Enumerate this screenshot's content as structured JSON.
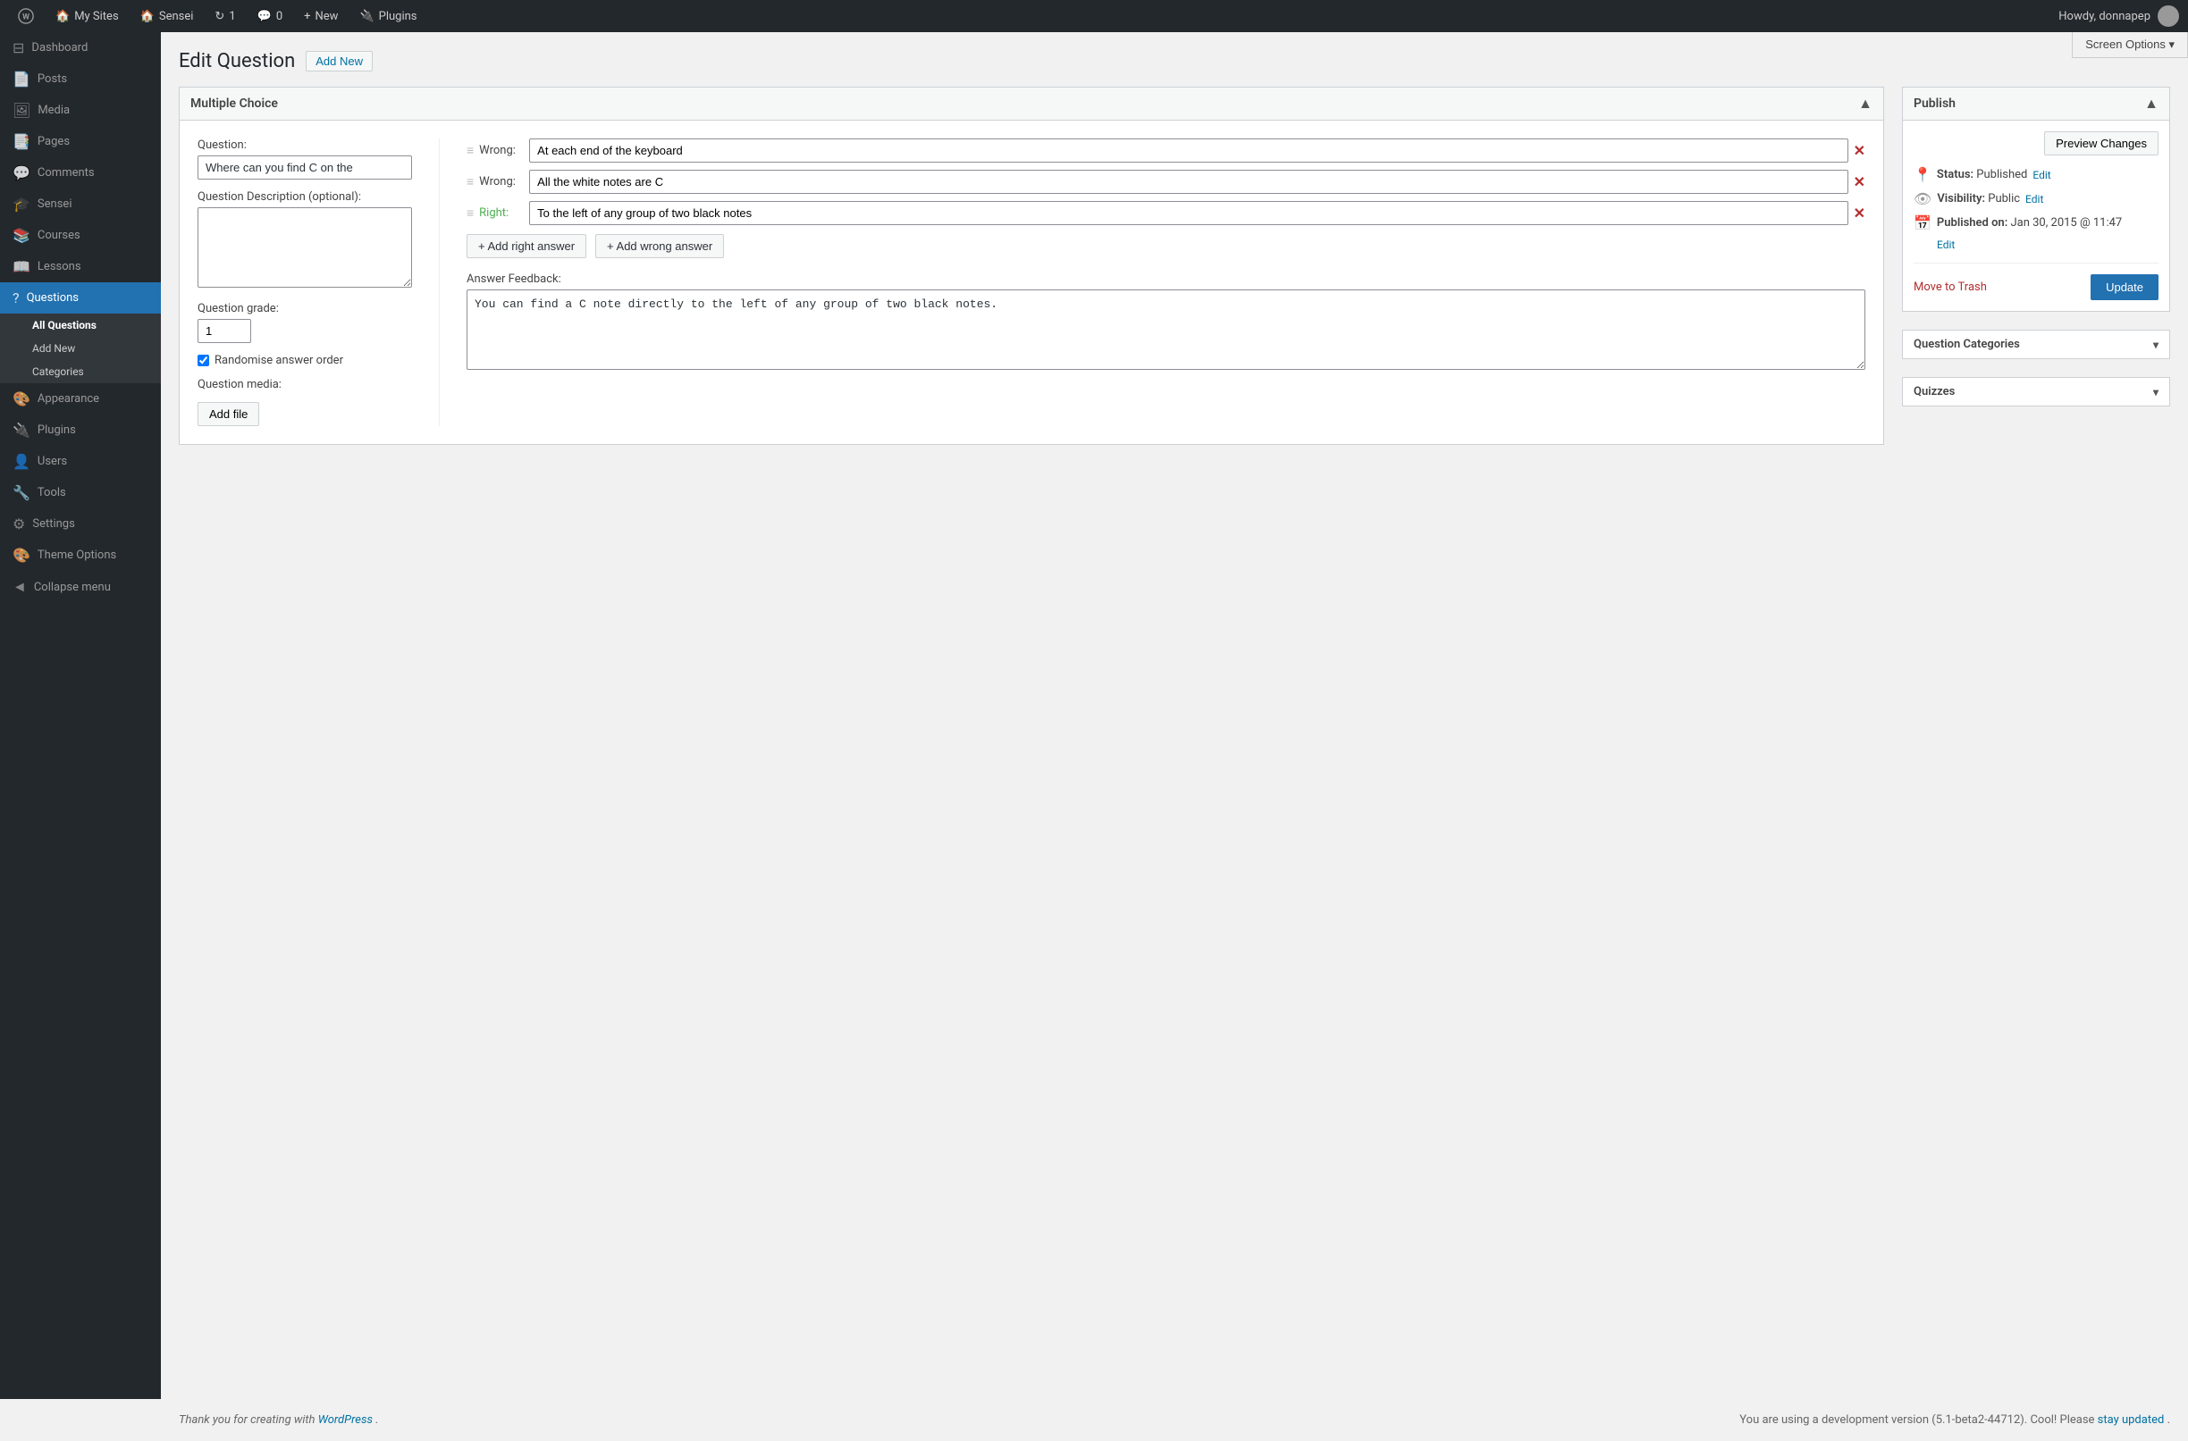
{
  "adminbar": {
    "wp_logo": "⊞",
    "items": [
      {
        "label": "My Sites",
        "icon": "🏠"
      },
      {
        "label": "Sensei",
        "icon": "🏠"
      },
      {
        "label": "1",
        "icon": "↻"
      },
      {
        "label": "0",
        "icon": "💬"
      },
      {
        "label": "New",
        "icon": "+"
      },
      {
        "label": "Plugins",
        "icon": "🔌"
      }
    ],
    "user": "Howdy, donnapep"
  },
  "screen_options": "Screen Options ▾",
  "page": {
    "title": "Edit Question",
    "add_new_label": "Add New"
  },
  "sidebar_menu": {
    "items": [
      {
        "label": "Dashboard",
        "icon": "⊟",
        "active": false
      },
      {
        "label": "Posts",
        "icon": "📄",
        "active": false
      },
      {
        "label": "Media",
        "icon": "🖼",
        "active": false
      },
      {
        "label": "Pages",
        "icon": "📑",
        "active": false
      },
      {
        "label": "Comments",
        "icon": "💬",
        "active": false
      },
      {
        "label": "Sensei",
        "icon": "🎓",
        "active": false
      },
      {
        "label": "Courses",
        "icon": "📚",
        "active": false
      },
      {
        "label": "Lessons",
        "icon": "📖",
        "active": false
      },
      {
        "label": "Questions",
        "icon": "?",
        "active": true
      },
      {
        "label": "Appearance",
        "icon": "🎨",
        "active": false
      },
      {
        "label": "Plugins",
        "icon": "🔌",
        "active": false
      },
      {
        "label": "Users",
        "icon": "👤",
        "active": false
      },
      {
        "label": "Tools",
        "icon": "🔧",
        "active": false
      },
      {
        "label": "Settings",
        "icon": "⚙",
        "active": false
      },
      {
        "label": "Theme Options",
        "icon": "🎨",
        "active": false
      },
      {
        "label": "Collapse menu",
        "icon": "◄",
        "active": false
      }
    ],
    "submenu": {
      "parent": "Questions",
      "items": [
        {
          "label": "All Questions",
          "active": true
        },
        {
          "label": "Add New",
          "active": false
        },
        {
          "label": "Categories",
          "active": false
        }
      ]
    }
  },
  "multiple_choice": {
    "header": "Multiple Choice",
    "question_label": "Question:",
    "question_value": "Where can you find C on the",
    "question_desc_label": "Question Description (optional):",
    "question_desc_value": "",
    "question_grade_label": "Question grade:",
    "question_grade_value": "1",
    "randomise_label": "Randomise answer order",
    "randomise_checked": true,
    "question_media_label": "Question media:",
    "add_file_label": "Add file",
    "answers": [
      {
        "type": "Wrong",
        "value": "At each end of the keyboard",
        "remove": "×"
      },
      {
        "type": "Wrong",
        "value": "All the white notes are C",
        "remove": "×"
      },
      {
        "type": "Right",
        "value": "To the left of any group of two black notes",
        "remove": "×"
      }
    ],
    "add_right_label": "+ Add right answer",
    "add_wrong_label": "+ Add wrong answer",
    "feedback_label": "Answer Feedback:",
    "feedback_value": "You can find a C note directly to the left of any group of two black notes."
  },
  "publish_panel": {
    "header": "Publish",
    "preview_changes_label": "Preview Changes",
    "status_label": "Status:",
    "status_value": "Published",
    "status_edit": "Edit",
    "visibility_label": "Visibility:",
    "visibility_value": "Public",
    "visibility_edit": "Edit",
    "published_on_label": "Published on:",
    "published_on_value": "Jan 30, 2015 @ 11:47",
    "published_edit": "Edit",
    "move_to_trash": "Move to Trash",
    "update_label": "Update"
  },
  "question_categories": {
    "header": "Question Categories"
  },
  "quizzes": {
    "header": "Quizzes"
  },
  "footer": {
    "thank_you_text": "Thank you for creating with",
    "wordpress_link": "WordPress",
    "thank_you_suffix": ".",
    "version_text": "You are using a development version (5.1-beta2-44712). Cool! Please",
    "stay_updated_link": "stay updated",
    "version_suffix": "."
  }
}
